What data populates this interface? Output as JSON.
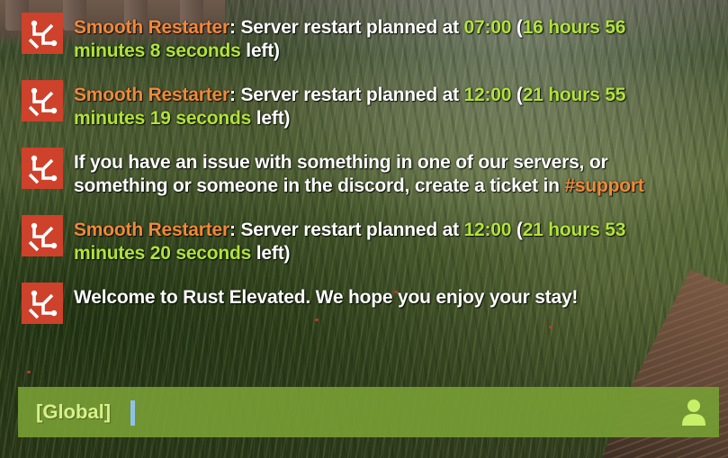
{
  "chat": {
    "messages": [
      {
        "sender": "Smooth Restarter",
        "sep": ": ",
        "pre": "Server restart planned at ",
        "time": "07:00",
        "open": " (",
        "left_amount": "16 hours 56 minutes 8 seconds",
        "close": " left)"
      },
      {
        "sender": "Smooth Restarter",
        "sep": ": ",
        "pre": "Server restart planned at ",
        "time": "12:00",
        "open": " (",
        "left_amount": "21 hours 55 minutes 19 seconds",
        "close": " left)"
      },
      {
        "text": "If you have an issue with something in one of our servers, or something or someone in the discord, create a ticket in ",
        "channel": "#support"
      },
      {
        "sender": "Smooth Restarter",
        "sep": ": ",
        "pre": "Server restart planned at ",
        "time": "12:00",
        "open": " (",
        "left_amount": "21 hours 53 minutes 20 seconds",
        "close": " left)"
      },
      {
        "text": "Welcome to Rust Elevated. We hope you enjoy your stay!"
      }
    ]
  },
  "input": {
    "channel": "[Global]",
    "value": "",
    "placeholder": ""
  },
  "icons": {
    "message_avatar": "rust-logo-icon",
    "input_right": "person-icon"
  },
  "colors": {
    "accent_orange": "#f0893a",
    "accent_green": "#b2e33a",
    "avatar_red": "#ce412b",
    "input_bar": "#769c34",
    "channel_text": "#d7f08a",
    "caret": "#8ec1e8"
  }
}
